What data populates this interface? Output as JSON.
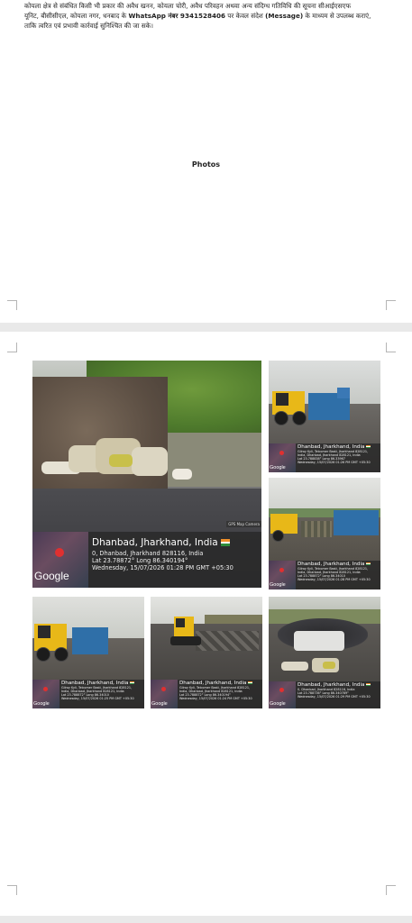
{
  "page1": {
    "paragraph": {
      "line1": "कोयला क्षेत्र से संबंधित किसी भी प्रकार की अवैध खनन, कोयला चोरी, अवैध परिवहन अथवा अन्य संदिग्ध गतिविधि की सूचना सीआईएसएफ",
      "line2a": "यूनिट, बीसीसीएल, कोयला नगर, धनबाद के ",
      "line2b": "WhatsApp नंबर 9341528406",
      "line2c": " पर केवल संदेश ",
      "line2d": "(Message)",
      "line2e": " के माध्यम से उपलब्ध कराएं,",
      "line3": "ताकि त्वरित एवं प्रभावी कार्रवाई सुनिश्चित की जा सके।"
    },
    "photos_heading": "Photos"
  },
  "photos": {
    "main": {
      "camera_tag": "GPS Map Camera",
      "city": "Dhanbad, Jharkhand, India",
      "address": "0, Dhanbad, Jharkhand 828116, India",
      "latlong": "Lat 23.78872° Long 86.340194°",
      "datetime": "Wednesday, 15/07/2026 01:28 PM GMT +05:30",
      "google": "Google"
    },
    "p2": {
      "city": "Dhanbad, Jharkhand, India",
      "l1": "Gilroy Kyli, Telcomer Basti, Jharkhand 828121,",
      "l2": "India, Dhanbad, Jharkhand 828121, India",
      "l3": "Lat 23.788838° Long 86.33967",
      "l4": "Wednesday, 15/07/2026 01:26 PM GMT +05:30",
      "google": "Google"
    },
    "p3": {
      "city": "Dhanbad, Jharkhand, India",
      "l1": "Gilroy Kyli, Telcomer Basti, Jharkhand 828121,",
      "l2": "India, Dhanbad, Jharkhand 828121, India",
      "l3": "Lat 23.788872° Long 86.34010",
      "l4": "Wednesday, 15/07/2026 01:28 PM GMT +05:30",
      "google": "Google"
    },
    "p4": {
      "city": "Dhanbad, Jharkhand, India",
      "l1": "Gilroy Kyli, Telcomer Basti, Jharkhand 828121,",
      "l2": "India, Dhanbad, Jharkhand 828121, India",
      "l3": "Lat 23.788872° Long 86.34010",
      "l4": "Wednesday, 15/07/2026 01:25 PM GMT +05:30",
      "google": "Google"
    },
    "p5": {
      "city": "Dhanbad, Jharkhand, India",
      "l1": "Gilroy Kyli, Telcomer Basti, Jharkhand 828121,",
      "l2": "India, Dhanbad, Jharkhand 828121, India",
      "l3": "Lat 23.788872° Long 86.340194°",
      "l4": "Wednesday, 15/07/2026 01:24 PM GMT +05:30",
      "google": "Google"
    },
    "p6": {
      "city": "Dhanbad, Jharkhand, India",
      "l1": "0, Dhanbad, Jharkhand 828116, India",
      "l2": "Lat 23.788736° Long 86.340789°",
      "l3": "Wednesday, 15/07/2026 01:29 PM GMT +05:30",
      "google": "Google"
    }
  },
  "colors": {
    "page_bg": "#ffffff",
    "viewer_bg": "#e9e9e9",
    "overlay_bg": "#2d2d2d",
    "map_pin": "#e03030"
  }
}
